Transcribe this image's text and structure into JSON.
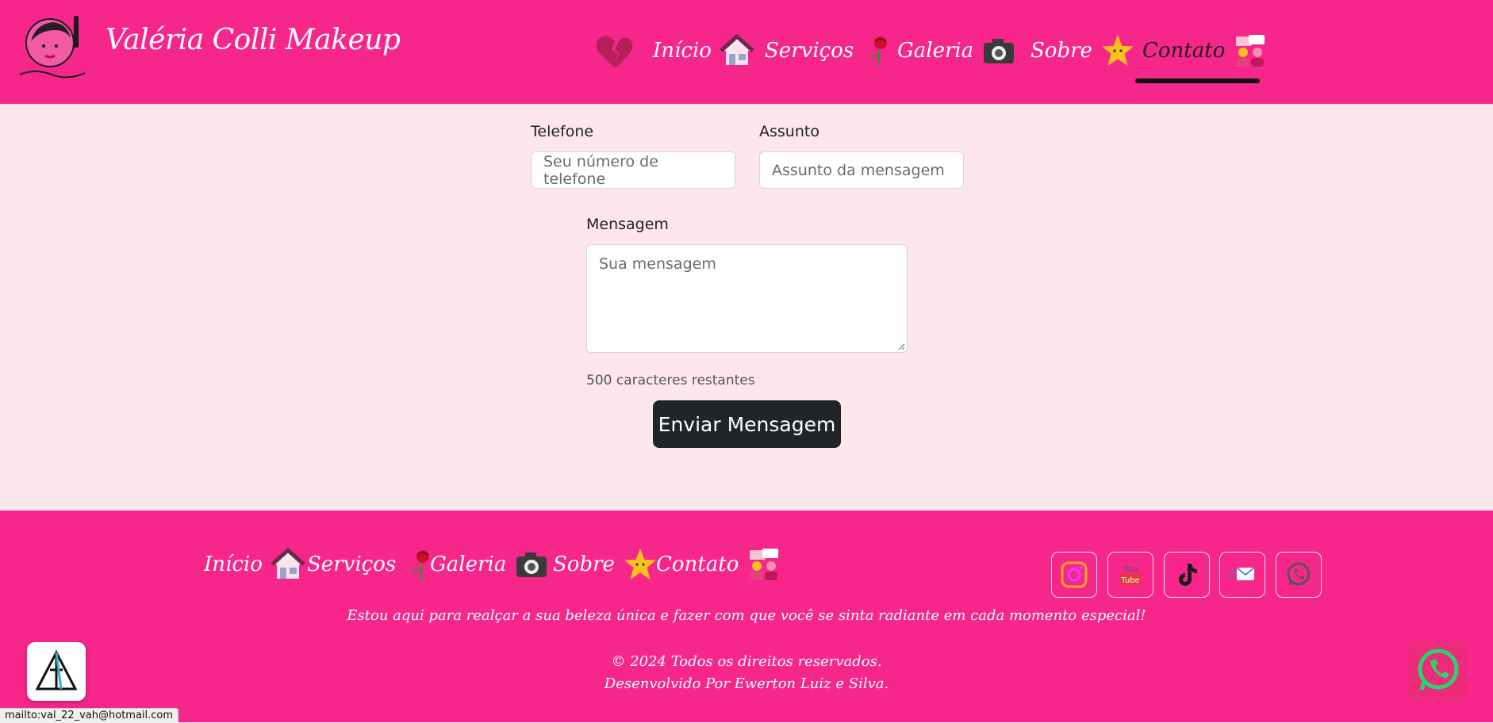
{
  "header": {
    "brand": "Valéria Colli Makeup",
    "nav": [
      {
        "label": "Início",
        "icon": "house-icon"
      },
      {
        "label": "Serviços",
        "icon": "rose-icon"
      },
      {
        "label": "Galeria",
        "icon": "camera-icon"
      },
      {
        "label": "Sobre",
        "icon": "star-icon"
      },
      {
        "label": "Contato",
        "icon": "people-chat-icon",
        "active": true
      }
    ]
  },
  "form": {
    "phone_label": "Telefone",
    "phone_placeholder": "Seu número de telefone",
    "subject_label": "Assunto",
    "subject_placeholder": "Assunto da mensagem",
    "message_label": "Mensagem",
    "message_placeholder": "Sua mensagem",
    "counter": "500 caracteres restantes",
    "submit": "Enviar Mensagem"
  },
  "footer": {
    "nav": [
      {
        "label": "Início",
        "icon": "house-icon"
      },
      {
        "label": "Serviços",
        "icon": "rose-icon"
      },
      {
        "label": "Galeria",
        "icon": "camera-icon"
      },
      {
        "label": "Sobre",
        "icon": "star-icon"
      },
      {
        "label": "Contato",
        "icon": "people-chat-icon"
      }
    ],
    "social": [
      "instagram-icon",
      "youtube-icon",
      "tiktok-icon",
      "email-icon",
      "whatsapp-icon"
    ],
    "tagline": "Estou aqui para realçar a sua beleza única e fazer com que você se sinta radiante em cada momento especial!",
    "copyright": "© 2024 Todos os direitos reservados.",
    "developer": "Desenvolvido Por Ewerton Luiz e Silva."
  },
  "status_bar": "mailto:val_22_vah@hotmail.com",
  "colors": {
    "brand_pink": "#f7268a",
    "page_bg": "#fde6ec",
    "button_dark": "#212529"
  }
}
